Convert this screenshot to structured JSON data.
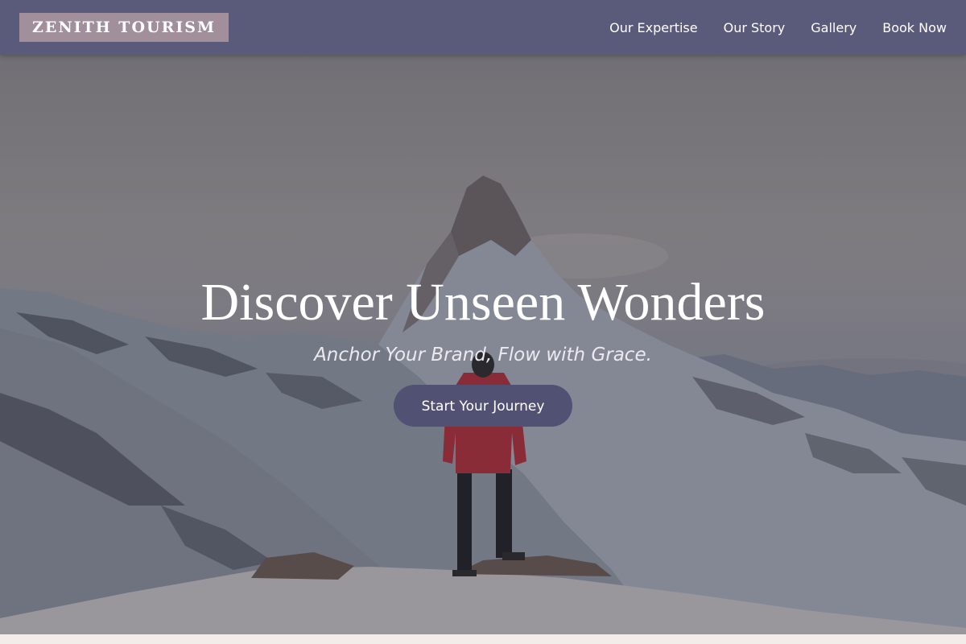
{
  "brand": {
    "name": "ZENITH TOURISM"
  },
  "nav": {
    "items": [
      {
        "label": "Our Expertise"
      },
      {
        "label": "Our Story"
      },
      {
        "label": "Gallery"
      },
      {
        "label": "Book Now"
      }
    ]
  },
  "hero": {
    "title": "Discover Unseen Wonders",
    "subtitle": "Anchor Your Brand, Flow with Grace.",
    "cta_label": "Start Your Journey",
    "image_subject": "snowy-mountain-peak-with-hiker"
  },
  "colors": {
    "navbar": "#5a5a7a",
    "logo_bg": "#a18f9c",
    "cta_bg": "#505173",
    "page_bg": "#f3ece8"
  }
}
